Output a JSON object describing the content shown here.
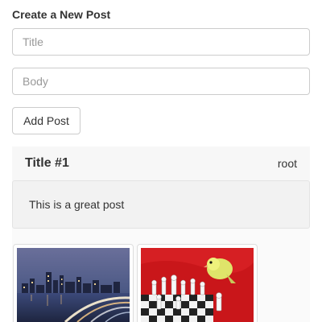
{
  "form": {
    "heading": "Create a New Post",
    "title_placeholder": "Title",
    "body_placeholder": "Body",
    "add_button_label": "Add Post"
  },
  "post": {
    "title": "Title #1",
    "author": "root",
    "body": "This is a great post"
  },
  "images": [
    {
      "icon": "city-skyline-night-image"
    },
    {
      "icon": "parrot-chess-image"
    }
  ]
}
